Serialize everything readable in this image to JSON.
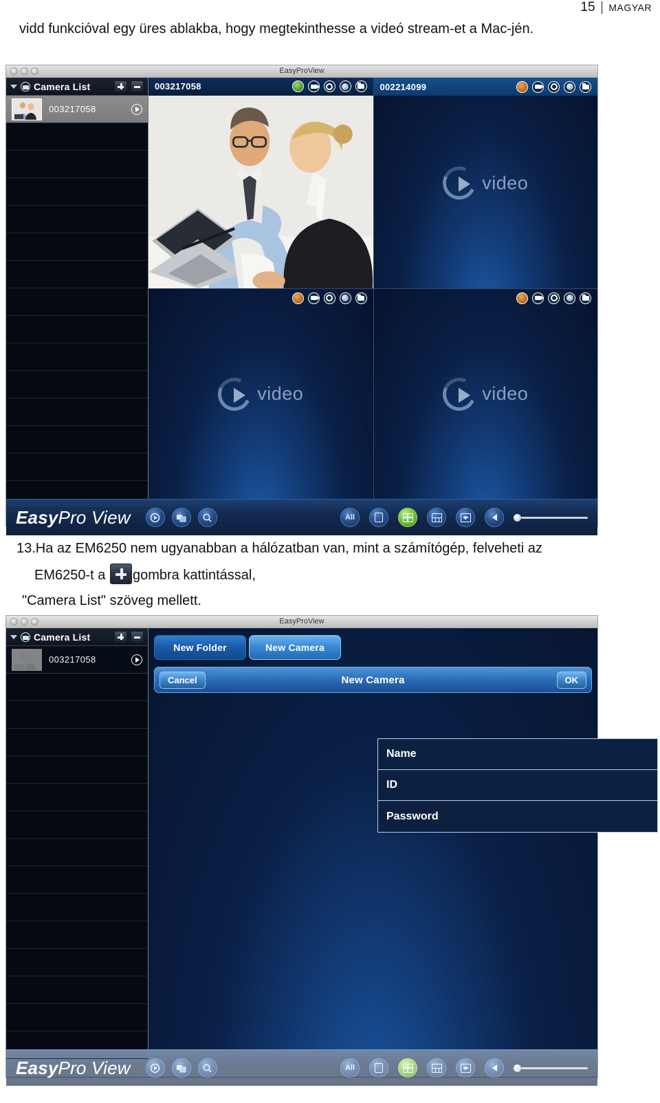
{
  "page_header": {
    "number": "15",
    "separator": "|",
    "category": "MAGYAR"
  },
  "paragraph_top": "vidd funkcióval egy üres ablakba, hogy megtekinthesse a videó stream-et a Mac-jén.",
  "instruction": {
    "line1": "13.Ha az EM6250 nem ugyanabban a hálózatban van, mint a számítógép, felveheti az",
    "line2_before": "EM6250-t a",
    "inline_button_icon": "plus-icon",
    "line2_after": "gombra kattintással,",
    "line3": "\"Camera List\" szöveg mellett."
  },
  "window_live": {
    "title": "EasyProView",
    "traffic_lights": [
      "close-button",
      "minimize-button",
      "zoom-button"
    ],
    "sidebar": {
      "disclosure_icon": "triangle-down-icon",
      "folder_icon": "folder-icon",
      "title": "Camera List",
      "add_label": "+",
      "remove_label": "−",
      "camera": {
        "id": "003217058",
        "chevron_icon": "chevron-right-icon",
        "selected": true
      }
    },
    "panes": [
      {
        "name": "003217058",
        "state": "live",
        "status": "online",
        "icons": [
          "status-icon",
          "record-icon",
          "snapshot-icon",
          "audio-icon",
          "folder-icon"
        ]
      },
      {
        "name": "002214099",
        "state": "placeholder",
        "status": "offline",
        "placeholder_text": "video",
        "icons": [
          "status-icon",
          "record-icon",
          "snapshot-icon",
          "audio-icon",
          "folder-icon"
        ]
      },
      {
        "name": "",
        "state": "placeholder",
        "status": "offline",
        "placeholder_text": "video",
        "icons": [
          "status-icon",
          "record-icon",
          "snapshot-icon",
          "audio-icon",
          "folder-icon"
        ]
      },
      {
        "name": "",
        "state": "placeholder",
        "status": "offline",
        "placeholder_text": "video",
        "icons": [
          "status-icon",
          "record-icon",
          "snapshot-icon",
          "audio-icon",
          "folder-icon"
        ]
      }
    ],
    "toolbar": {
      "logo_bold": "Easy",
      "logo_rest": "Pro View",
      "left_icons": [
        "playback-icon",
        "snapshot-gallery-icon",
        "search-icon"
      ],
      "all_label": "All",
      "layout_icons": [
        "layout-single-icon",
        "layout-quad-icon",
        "layout-six-icon",
        "layout-fullscreen-icon"
      ],
      "active_layout": "layout-quad-icon",
      "volume_icon": "speaker-icon",
      "volume_value": 0
    }
  },
  "window_dialog": {
    "title": "EasyProView",
    "traffic_lights": [
      "close-button",
      "minimize-button",
      "zoom-button"
    ],
    "sidebar": {
      "disclosure_icon": "triangle-down-icon",
      "folder_icon": "folder-icon",
      "title": "Camera List",
      "add_label": "+",
      "remove_label": "−",
      "camera": {
        "id": "003217058",
        "chevron_icon": "chevron-right-icon",
        "selected": false
      }
    },
    "tabs": [
      {
        "label": "New Folder",
        "active": false
      },
      {
        "label": "New Camera",
        "active": true
      }
    ],
    "dialog": {
      "cancel_label": "Cancel",
      "title": "New Camera",
      "ok_label": "OK",
      "fields": [
        {
          "label": "Name",
          "value": ""
        },
        {
          "label": "ID",
          "value": ""
        },
        {
          "label": "Password",
          "value": ""
        }
      ]
    },
    "toolbar": {
      "logo_bold": "Easy",
      "logo_rest": "Pro View",
      "left_icons": [
        "playback-icon",
        "snapshot-gallery-icon",
        "search-icon"
      ],
      "all_label": "All",
      "layout_icons": [
        "layout-single-icon",
        "layout-quad-icon",
        "layout-six-icon",
        "layout-fullscreen-icon"
      ],
      "active_layout": "layout-quad-icon",
      "volume_icon": "speaker-icon",
      "volume_value": 0
    }
  },
  "colors": {
    "accent_blue": "#2f7ed1",
    "status_online": "#74c43a",
    "status_offline": "#b3621c",
    "panel_dark": "#06122c",
    "titlebar": "#cfcfcf"
  }
}
